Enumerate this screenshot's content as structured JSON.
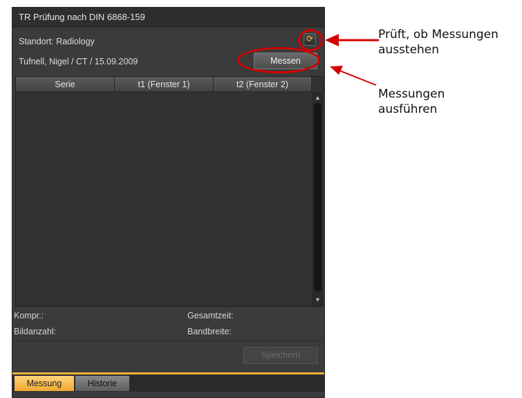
{
  "panel": {
    "title": "TR Prüfung nach DIN 6868-159",
    "location_text": "Standort: Radiology",
    "patient_text": "Tufnell, Nigel / CT / 15.09.2009",
    "refresh_icon": "⟳",
    "measure_button": "Messen",
    "table": {
      "columns": [
        "Serie",
        "t1 (Fenster 1)",
        "t2 (Fenster 2)"
      ],
      "rows": []
    },
    "stats": {
      "kompr": "Kompr.:",
      "gesamtzeit": "Gesamtzeit:",
      "bildanzahl": "Bildanzahl:",
      "bandbreite": "Bandbreite:"
    },
    "save_button": "Speichern",
    "tabs": [
      "Messung",
      "Historie"
    ]
  },
  "annotations": {
    "check_pending": "Prüft, ob Messungen ausstehen",
    "run_measurements": "Messungen ausführen",
    "color": "#d60000"
  }
}
